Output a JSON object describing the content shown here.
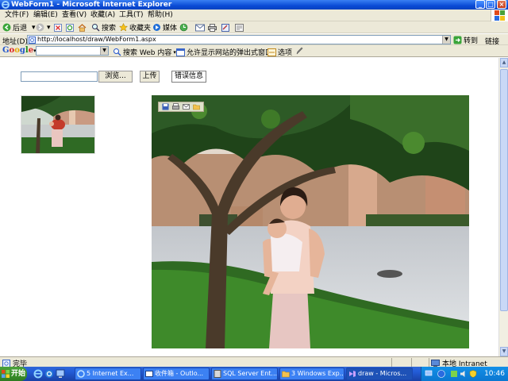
{
  "window": {
    "title": "WebForm1 - Microsoft Internet Explorer",
    "minimize": "_",
    "maximize": "□",
    "close": "×"
  },
  "menu": [
    "文件(F)",
    "编辑(E)",
    "查看(V)",
    "收藏(A)",
    "工具(T)",
    "帮助(H)"
  ],
  "toolbar": {
    "back": "后退",
    "search": "搜索",
    "favorites": "收藏夹",
    "media": "媒体"
  },
  "address": {
    "label": "地址(D)",
    "url": "http://localhost/draw/WebForm1.aspx",
    "go": "转到",
    "links": "链接"
  },
  "googlebar": {
    "logo": [
      "G",
      "o",
      "o",
      "g",
      "l",
      "e"
    ],
    "search_web": "搜索 Web 内容",
    "popups_allowed": "允许显示网站的弹出式窗口",
    "options": "选项"
  },
  "page": {
    "file_input_value": "",
    "browse_button": "浏览...",
    "upload_button": "上传",
    "message_box": "错误信息",
    "image_toolbar_icons": [
      "save-icon",
      "print-icon",
      "email-icon",
      "folder-icon"
    ]
  },
  "status": {
    "text": "完毕",
    "zone": "本地 Intranet"
  },
  "taskbar": {
    "start": "开始",
    "tasks": [
      "5 Internet Ex...",
      "收件箱 - Outlo...",
      "SQL Server Ent...",
      "3 Windows Exp...",
      "draw - Micros..."
    ],
    "clock": "10:46"
  },
  "colors": {
    "title_blue": "#0a4bd6",
    "chrome": "#ece9d8",
    "taskbar_blue": "#245edb",
    "start_green": "#3a8f2a",
    "tray_blue": "#0b77d0"
  }
}
